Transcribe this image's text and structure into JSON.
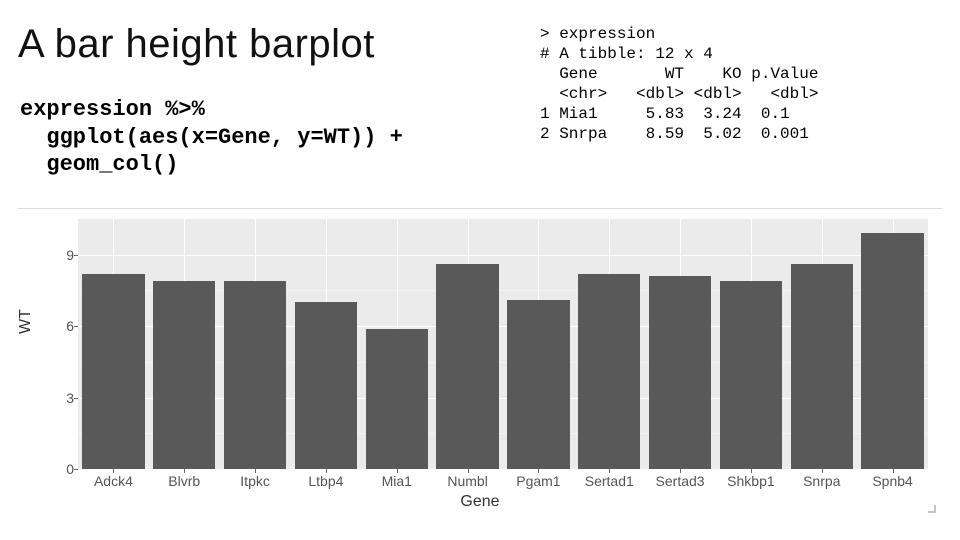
{
  "title": "A bar height barplot",
  "code": "expression %>%\n  ggplot(aes(x=Gene, y=WT)) +\n  geom_col()",
  "console": "> expression\n# A tibble: 12 x 4\n  Gene       WT    KO p.Value\n  <chr>   <dbl> <dbl>   <dbl>\n1 Mia1     5.83  3.24  0.1\n2 Snrpa    8.59  5.02  0.001",
  "axis": {
    "x_title": "Gene",
    "y_title": "WT",
    "y_ticks": [
      0,
      3,
      6,
      9
    ]
  },
  "chart_data": {
    "type": "bar",
    "title": "",
    "xlabel": "Gene",
    "ylabel": "WT",
    "ylim": [
      0,
      10.5
    ],
    "categories": [
      "Adck4",
      "Blvrb",
      "Itpkc",
      "Ltbp4",
      "Mia1",
      "Numbl",
      "Pgam1",
      "Sertad1",
      "Sertad3",
      "Shkbp1",
      "Snrpa",
      "Spnb4"
    ],
    "values": [
      8.2,
      7.9,
      7.9,
      7.0,
      5.9,
      8.6,
      7.1,
      8.2,
      8.1,
      7.9,
      8.6,
      9.9
    ]
  }
}
